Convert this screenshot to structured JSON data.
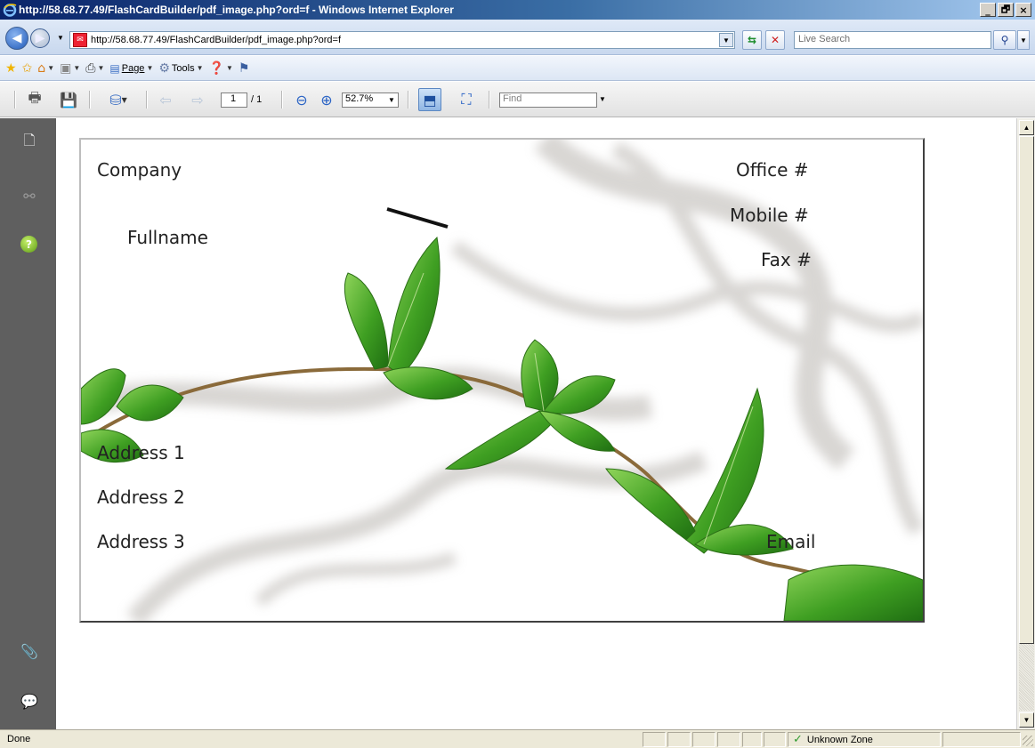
{
  "window": {
    "title": "http://58.68.77.49/FlashCardBuilder/pdf_image.php?ord=f - Windows Internet Explorer",
    "minimize_label": "_",
    "maximize_label": "🗗",
    "close_label": "×"
  },
  "address_bar": {
    "url": "http://58.68.77.49/FlashCardBuilder/pdf_image.php?ord=f",
    "search_placeholder": "Live Search"
  },
  "command_bar": {
    "page_label": "Page",
    "tools_label": "Tools"
  },
  "pdf_toolbar": {
    "current_page": "1",
    "total_pages": "/ 1",
    "zoom": "52.7%",
    "find_placeholder": "Find"
  },
  "card": {
    "company": "Company",
    "fullname": "Fullname",
    "office": "Office #",
    "mobile": "Mobile #",
    "fax": "Fax #",
    "address1": "Address 1",
    "address2": "Address 2",
    "address3": "Address 3",
    "email": "Email"
  },
  "status_bar": {
    "status": "Done",
    "zone": "Unknown Zone"
  },
  "colors": {
    "leaf_green": "#3f9f22",
    "panel_gray": "#5f5f5f",
    "title_blue": "#0a246a"
  }
}
